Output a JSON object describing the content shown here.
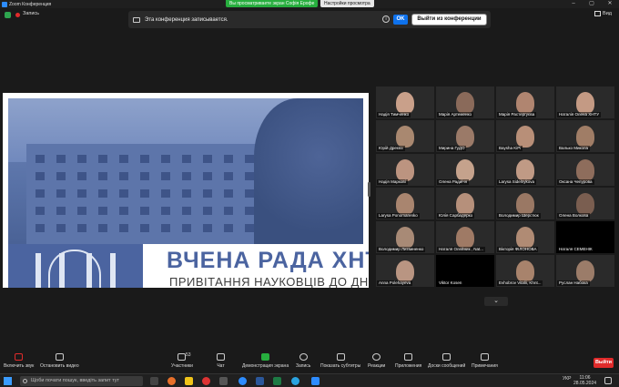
{
  "window": {
    "title": "Zoom Конференция",
    "controls": [
      "–",
      "▢",
      "✕"
    ]
  },
  "viewing_pill": "Вы просматриваете экран Софія Ерофе",
  "view_options_pill": "Настройки просмотра",
  "recording": {
    "label": "Запись"
  },
  "view_button": "Вид",
  "banner": {
    "message": "Эта конференция записывается.",
    "ok_label": "OK",
    "exit_label": "Выйти из конференции",
    "info_glyph": "i"
  },
  "slide": {
    "title": "ВЧЕНА РАДА ХНТУ",
    "subtitle": "ПРИВІТАННЯ НАУКОВЦІВ ДО ДНЯ НАУКИ"
  },
  "participants": [
    {
      "name": "Надія Тимченко",
      "skin": "#c9a08a"
    },
    {
      "name": "Марія Артеменко",
      "skin": "#8a6a5a"
    },
    {
      "name": "Марія Растергуєва",
      "skin": "#b08570"
    },
    {
      "name": "Наталія Олена ХНТУ",
      "skin": "#c49a84"
    },
    {
      "name": "Юрій Дреєвз",
      "skin": "#a98870"
    },
    {
      "name": "Мирина ГуДО",
      "skin": "#9b7a68"
    },
    {
      "name": "Baysha KiPi",
      "skin": "#b88f78"
    },
    {
      "name": "Валько Микола",
      "skin": "#a07d66"
    },
    {
      "name": "Надія Маркові",
      "skin": "#bc9480"
    },
    {
      "name": "Олена Радиічн",
      "skin": "#c5a28c"
    },
    {
      "name": "Larysa Sidelnykova",
      "skin": "#c09a85"
    },
    {
      "name": "Оксана Чепурова",
      "skin": "#8e6d5c"
    },
    {
      "name": "Larysa Ponomarenko",
      "skin": "#a9856f"
    },
    {
      "name": "Юлія Сарбадерко",
      "skin": "#b6907b"
    },
    {
      "name": "Володимир Шерстюк",
      "skin": "#9a7864"
    },
    {
      "name": "Олена Волкова",
      "skin": "#7a5e50"
    },
    {
      "name": "Володимир Литвиненко",
      "skin": "#a88a76"
    },
    {
      "name": "Наталя Олейник , Nat...",
      "skin": "#9f7a65"
    },
    {
      "name": "Вікторія ФІЛОНОВА",
      "skin": "#b08b74"
    },
    {
      "name": "Наталя СЕМЕНІК",
      "skin": "#000000"
    },
    {
      "name": "Anna Polehayeva",
      "skin": "#b99582"
    },
    {
      "name": "Viktor Kosen",
      "skin": "#000000"
    },
    {
      "name": "Evhobrov Vitalii, Khnt...",
      "skin": "#a8836c"
    },
    {
      "name": "Руслан Набока",
      "skin": "#9b7c69"
    }
  ],
  "collapse_glyph": "⌄",
  "toolbar": {
    "mic": "Включить звук",
    "video": "Остановить видео",
    "participants": "Участники",
    "participants_count": "53",
    "chat": "Чат",
    "share": "Демонстрация экрана",
    "record": "Запись",
    "captions": "Показать субтитры",
    "reactions": "Реакции",
    "apps": "Приложения",
    "whiteboard": "Доски сообщений",
    "notes": "Примечания",
    "exit": "Выйти"
  },
  "taskbar": {
    "search_placeholder": "Щоби почати пошук, введіть запит тут",
    "lang": "УКР",
    "time": "11:06",
    "date": "28.05.2024"
  }
}
